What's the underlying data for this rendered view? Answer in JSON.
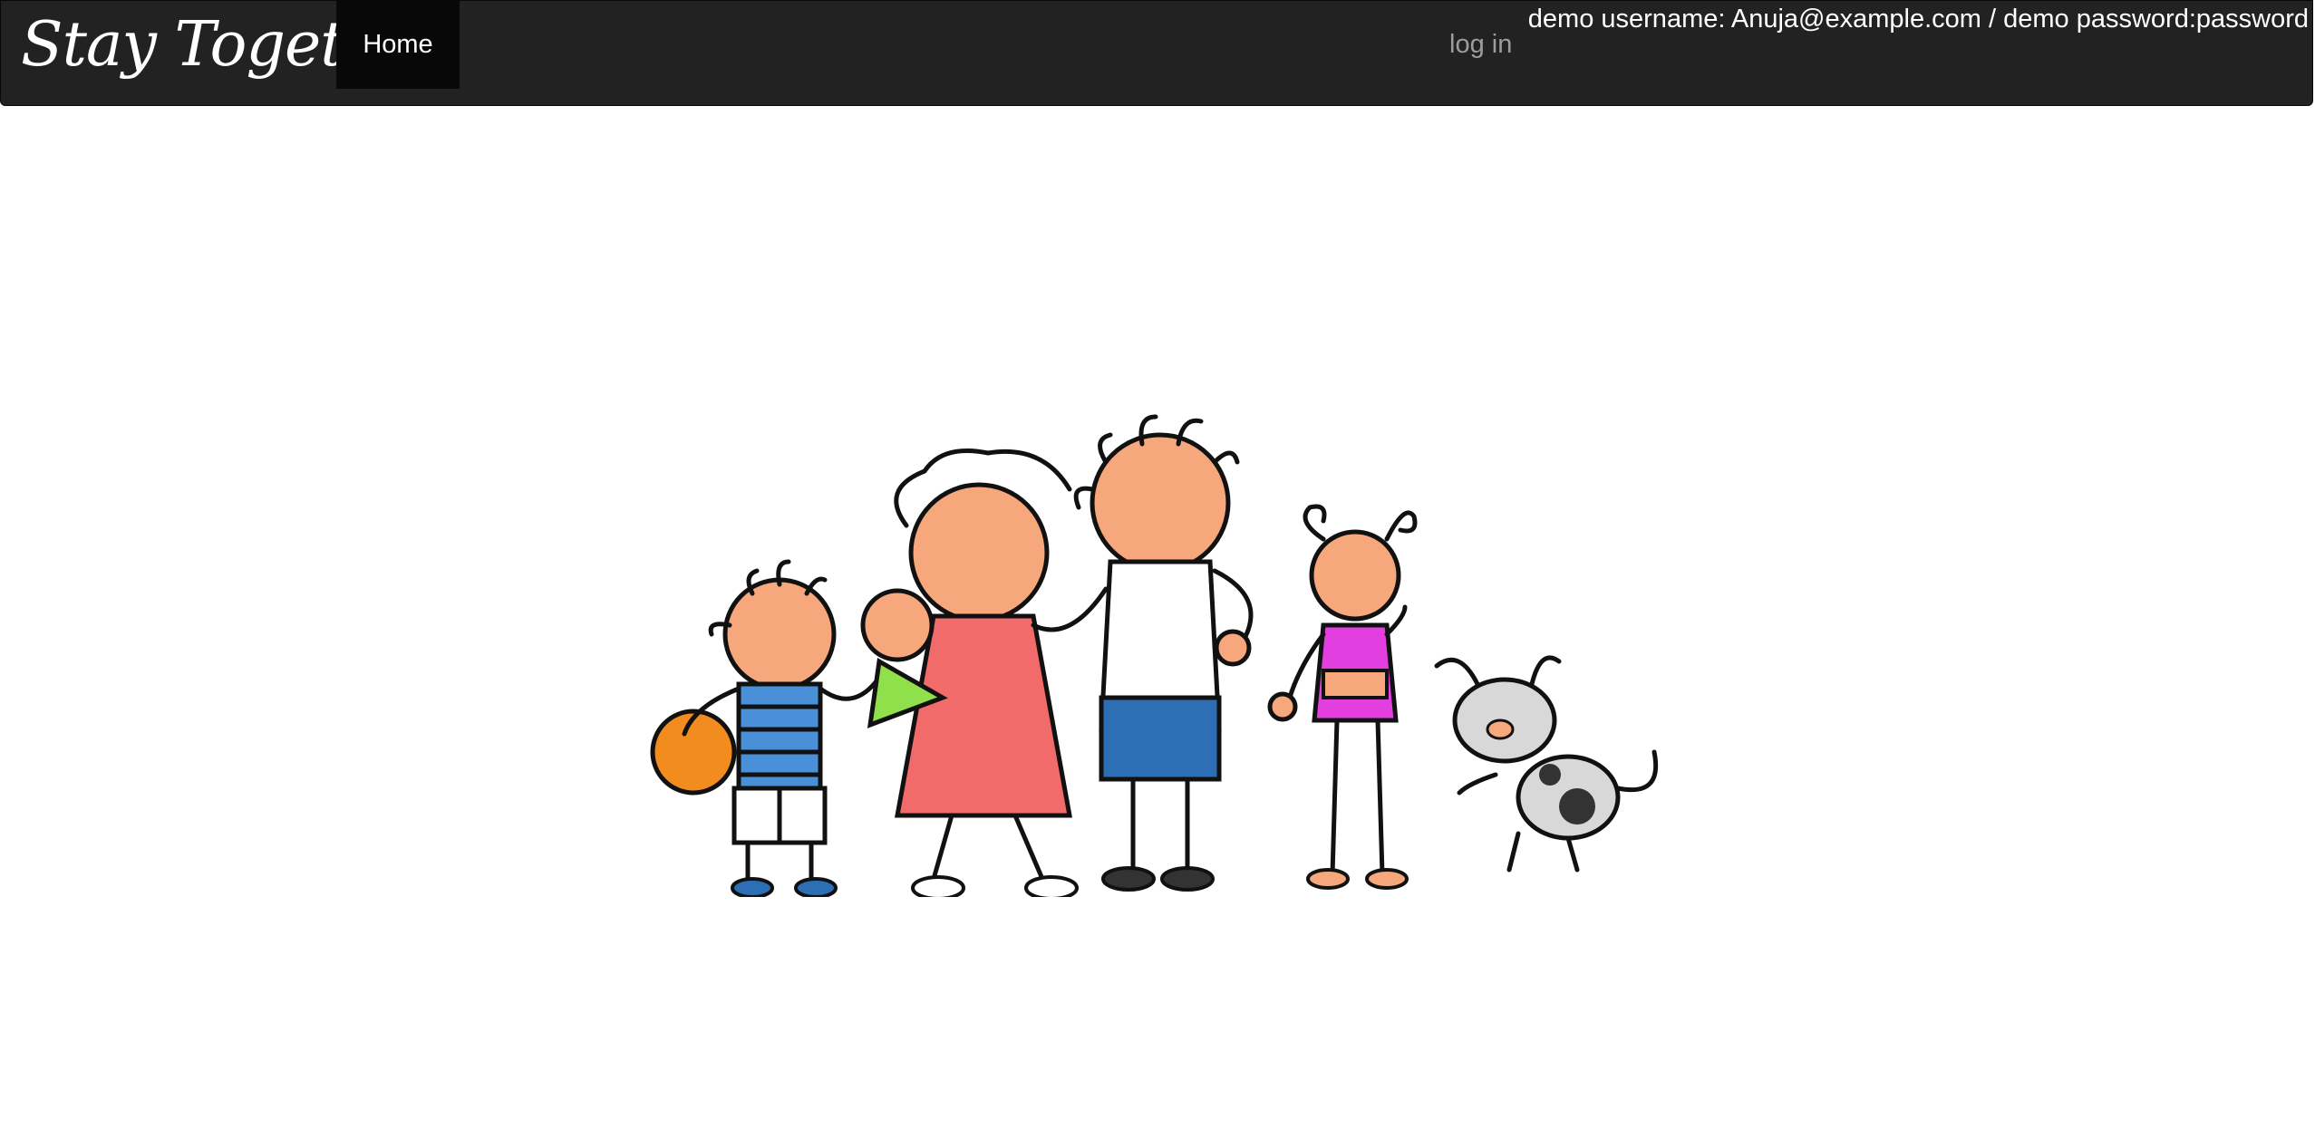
{
  "navbar": {
    "brand": "Stay Together",
    "home_label": "Home",
    "login_label": "log in",
    "demo_credentials": "demo username: Anuja@example.com / demo password:password"
  },
  "colors": {
    "navbar_bg": "#222222",
    "active_nav_bg": "#080808",
    "inactive_link": "#9d9d9d",
    "page_bg": "#ffffff"
  }
}
